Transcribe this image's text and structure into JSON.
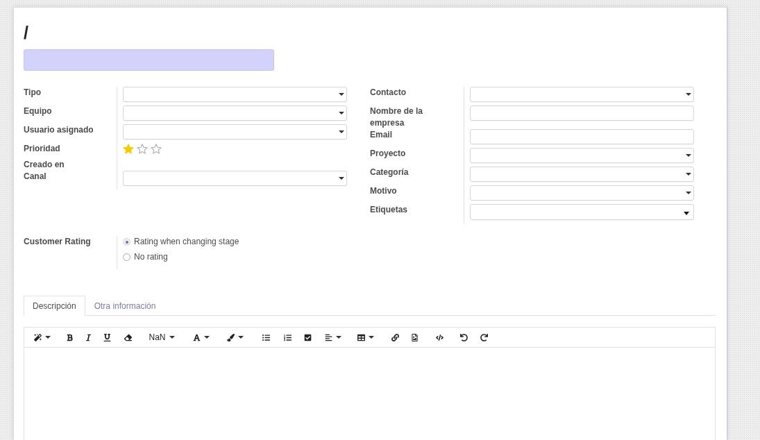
{
  "record": {
    "title": "/",
    "name_field": {
      "required": true
    }
  },
  "left_fields": [
    {
      "label": "Tipo",
      "kind": "select"
    },
    {
      "label": "Equipo",
      "kind": "select"
    },
    {
      "label": "Usuario asignado",
      "kind": "select"
    },
    {
      "label": "Prioridad",
      "kind": "priority",
      "stars": 1
    },
    {
      "label": "Creado en",
      "kind": "readonly"
    },
    {
      "label": "Canal",
      "kind": "select"
    }
  ],
  "right_fields": [
    {
      "label": "Contacto",
      "kind": "select"
    },
    {
      "label": "Nombre de la empresa",
      "kind": "text"
    },
    {
      "label": "Email",
      "kind": "text"
    },
    {
      "label": "Proyecto",
      "kind": "select"
    },
    {
      "label": "Categoría",
      "kind": "select"
    },
    {
      "label": "Motivo",
      "kind": "select"
    },
    {
      "label": "Etiquetas",
      "kind": "tags"
    }
  ],
  "customer_rating": {
    "label": "Customer Rating",
    "options": [
      {
        "label": "Rating when changing stage",
        "selected": true
      },
      {
        "label": "No rating",
        "selected": false
      }
    ]
  },
  "tabs": [
    {
      "label": "Descripción",
      "selected": true
    },
    {
      "label": "Otra información",
      "selected": false
    }
  ],
  "editor": {
    "font_size": "NaN"
  }
}
